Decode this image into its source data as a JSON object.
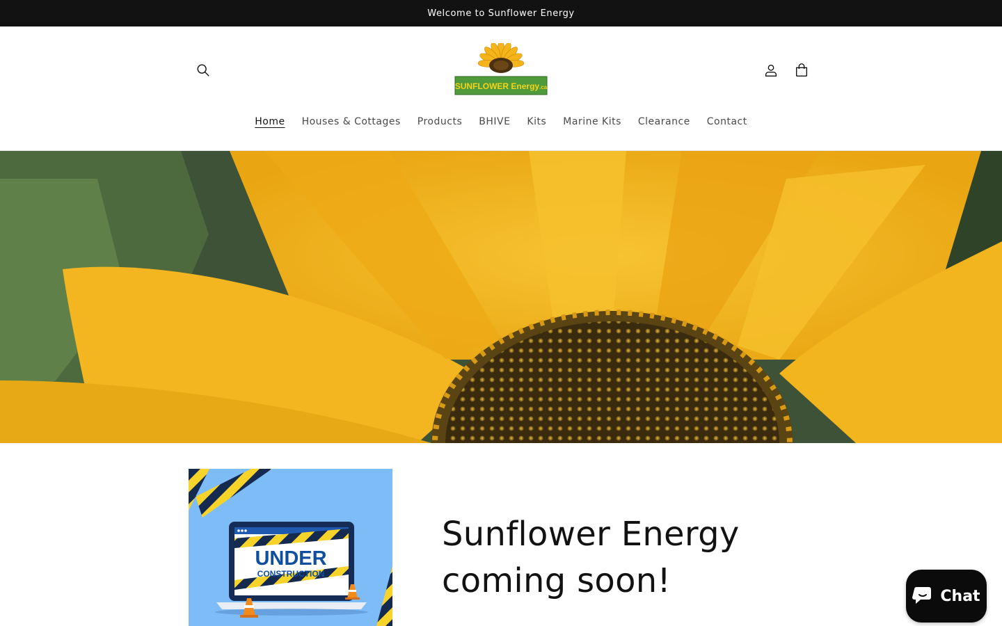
{
  "announcement": {
    "text": "Welcome to Sunflower Energy"
  },
  "header": {
    "logo_text": "SUNFLOWER Energy",
    "logo_suffix": ".ca",
    "icons": {
      "search": "search-icon",
      "account": "account-icon",
      "cart": "cart-icon"
    }
  },
  "nav": {
    "items": [
      {
        "label": "Home",
        "active": true
      },
      {
        "label": "Houses & Cottages"
      },
      {
        "label": "Products"
      },
      {
        "label": "BHIVE"
      },
      {
        "label": "Kits"
      },
      {
        "label": "Marine Kits"
      },
      {
        "label": "Clearance"
      },
      {
        "label": "Contact"
      }
    ]
  },
  "main": {
    "construction_line1": "UNDER",
    "construction_line2": "CONSTRUCTION",
    "headline_line1": "Sunflower Energy",
    "headline_line2": "coming soon!"
  },
  "chat": {
    "label": "Chat"
  },
  "colors": {
    "announcement_bg": "#121212",
    "petal_yellow": "#f2b51d",
    "leaf_green": "#3f5a34",
    "construction_blue": "#7ebcf7",
    "construction_text": "#0f4fa0",
    "chat_bg": "#0b0b0b"
  }
}
